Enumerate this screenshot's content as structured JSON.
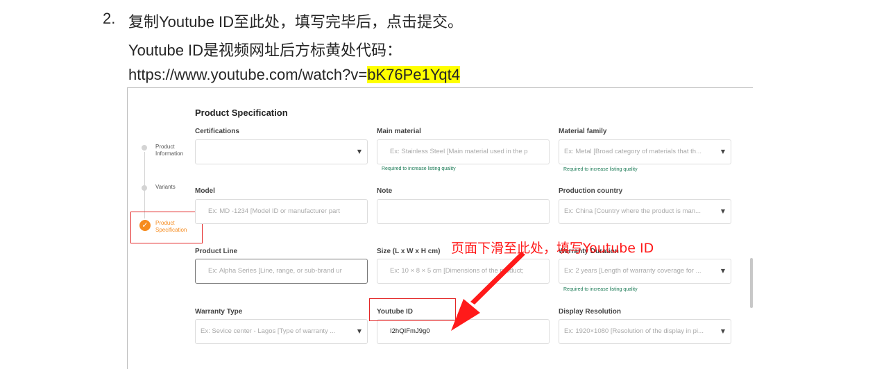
{
  "instruction": {
    "number": "2.",
    "line1": "复制Youtube ID至此处，填写完毕后，点击提交。",
    "line2": "Youtube ID是视频网址后方标黄处代码：",
    "url_prefix": "https://www.youtube.com/watch?v=",
    "url_highlight": "bK76Pe1Yqt4"
  },
  "stepper": {
    "steps": [
      {
        "label_line1": "Product",
        "label_line2": "Information"
      },
      {
        "label_line1": "Variants",
        "label_line2": ""
      },
      {
        "label_line1": "Product",
        "label_line2": "Specification"
      }
    ],
    "active_index": 2
  },
  "form": {
    "section_title": "Product Specification",
    "certifications": {
      "label": "Certifications",
      "value": ""
    },
    "main_material": {
      "label": "Main material",
      "placeholder": "Ex: Stainless Steel [Main material used in the p",
      "hint": "Required to increase listing quality"
    },
    "material_family": {
      "label": "Material family",
      "placeholder": "Ex: Metal [Broad category of materials that th...",
      "hint": "Required to increase listing quality"
    },
    "model": {
      "label": "Model",
      "placeholder": "Ex: MD -1234 [Model ID or manufacturer part"
    },
    "note": {
      "label": "Note",
      "value": ""
    },
    "production_country": {
      "label": "Production country",
      "placeholder": "Ex: China [Country where the product is man..."
    },
    "product_line": {
      "label": "Product Line",
      "placeholder": "Ex: Alpha Series [Line, range, or sub-brand ur"
    },
    "size": {
      "label": "Size (L x W x H cm)",
      "placeholder": "Ex: 10 × 8 × 5 cm [Dimensions of the product;"
    },
    "warranty_duration": {
      "label": "Warranty Duration",
      "placeholder": "Ex: 2 years [Length of warranty coverage for ...",
      "hint": "Required to increase listing quality"
    },
    "warranty_type": {
      "label": "Warranty Type",
      "placeholder": "Ex: Sevice center - Lagos [Type of warranty ..."
    },
    "youtube_id": {
      "label": "Youtube ID",
      "value": "I2hQIFmJ9g0"
    },
    "display_resolution": {
      "label": "Display Resolution",
      "placeholder": "Ex: 1920×1080 [Resolution of the display in pi..."
    }
  },
  "annotation": {
    "text": "页面下滑至此处，填写Youtube ID",
    "color": "#ff1a1a"
  },
  "colors": {
    "accent": "#f68b1e",
    "highlight": "#ffff00",
    "hint": "#1a7a55",
    "annotation_box": "#e32626"
  }
}
